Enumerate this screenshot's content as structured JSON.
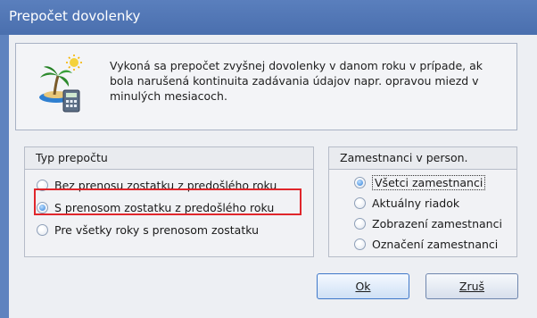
{
  "window": {
    "title": "Prepočet dovolenky"
  },
  "info": {
    "text": "Vykoná sa prepočet zvyšnej dovolenky v danom roku v prípade, ak bola narušená kontinuita zadávania údajov napr. opravou miezd v minulých mesiacoch."
  },
  "calc_type": {
    "title": "Typ prepočtu",
    "options": [
      {
        "label": "Bez prenosu zostatku z predošlého roku",
        "selected": false
      },
      {
        "label": "S prenosom zostatku z predošlého roku",
        "selected": true
      },
      {
        "label": "Pre všetky roky s prenosom zostatku",
        "selected": false
      }
    ]
  },
  "employees": {
    "title": "Zamestnanci v person.",
    "options": [
      {
        "label": "Všetci zamestnanci",
        "selected": true
      },
      {
        "label": "Aktuálny riadok",
        "selected": false
      },
      {
        "label": "Zobrazení zamestnanci",
        "selected": false
      },
      {
        "label": "Označení zamestnanci",
        "selected": false
      }
    ]
  },
  "buttons": {
    "ok": "Ok",
    "cancel": "Zruš"
  },
  "colors": {
    "titlebar": "#4f74b4",
    "highlight": "#e0262b",
    "radio_selected": "#2f7fd8"
  },
  "icons": {
    "app": "palm-island-calculator-icon"
  }
}
